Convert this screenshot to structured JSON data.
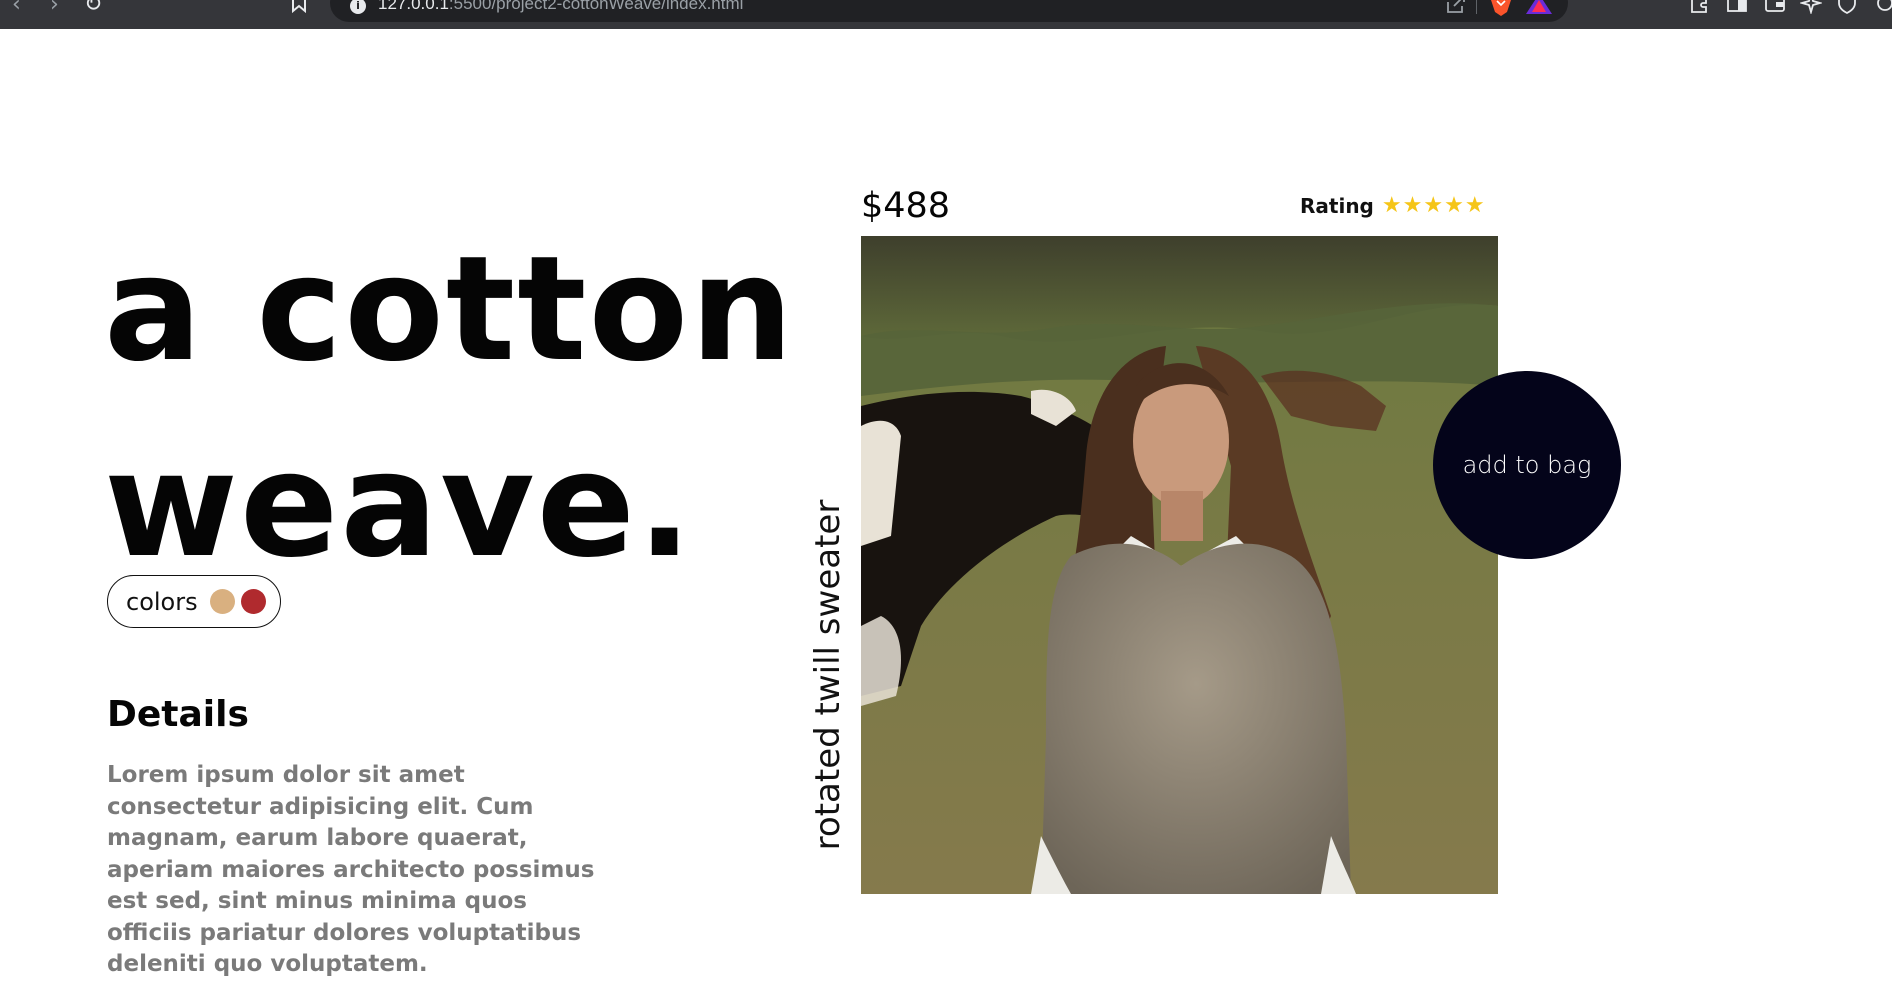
{
  "browser": {
    "url_host": "127.0.0.1",
    "url_path": ":5500/project2-cottonWeave/index.html",
    "icons": [
      "back-icon",
      "forward-icon",
      "reload-icon",
      "bookmark-icon",
      "info-icon",
      "share-icon",
      "brave-shields-icon",
      "brave-rewards-icon",
      "extensions-icon",
      "sidebar-icon",
      "wallet-icon",
      "leo-ai-icon",
      "vpn-icon"
    ],
    "glyphs": {
      "back": "‹",
      "forward": "›",
      "reload": "↻"
    }
  },
  "hero": {
    "line1": "a cotton",
    "line2": "weave."
  },
  "colors": {
    "label": "colors",
    "swatches": [
      "#d9b080",
      "#b02a2e"
    ]
  },
  "details": {
    "title": "Details",
    "body": "Lorem ipsum dolor sit amet consectetur adipisicing elit. Cum magnam, earum labore quaerat, aperiam maiores architecto possimus est sed, sint minus minima quos officiis pariatur dolores voluptatibus deleniti quo voluptatem."
  },
  "product": {
    "price": "$488",
    "rating_label": "Rating",
    "rating_stars": 5,
    "star_glyph": "★",
    "name": "rotated twill sweater",
    "cta": "add to bag"
  },
  "theme": {
    "cta_bg": "#04041a",
    "star_color": "#f5c518",
    "body_text": "#7a7a7a"
  }
}
